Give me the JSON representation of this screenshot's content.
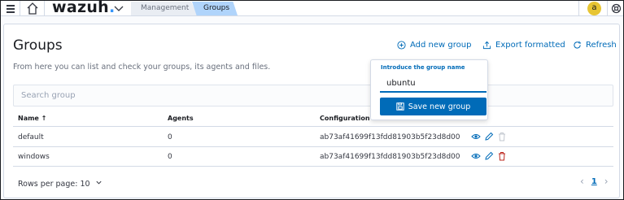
{
  "header": {
    "logo_text": "wazuh",
    "logo_dot": ".",
    "breadcrumbs": [
      "Management",
      "Groups"
    ],
    "user_initial": "a"
  },
  "page": {
    "title": "Groups",
    "description": "From here you can list and check your groups, its agents and files.",
    "actions": {
      "add": "Add new group",
      "export": "Export formatted",
      "refresh": "Refresh"
    },
    "search_placeholder": "Search group"
  },
  "table": {
    "columns": {
      "name": "Name",
      "name_sort": "↑",
      "agents": "Agents",
      "config": "Configuration check"
    },
    "rows": [
      {
        "name": "default",
        "agents": "0",
        "config": "ab73af41699f13fdd81903b5f23d8d00"
      },
      {
        "name": "windows",
        "agents": "0",
        "config": "ab73af41699f13fdd81903b5f23d8d00"
      }
    ]
  },
  "pagination": {
    "rows_per_page_label": "Rows per page: 10",
    "current_page": "1"
  },
  "popover": {
    "label": "Introduce the group name",
    "input_value": "ubuntu",
    "save_button": "Save new group"
  },
  "colors": {
    "accent": "#006bb8",
    "breadcrumb_active": "#b0d4fb",
    "danger": "#bd271e",
    "avatar": "#e7c533"
  }
}
